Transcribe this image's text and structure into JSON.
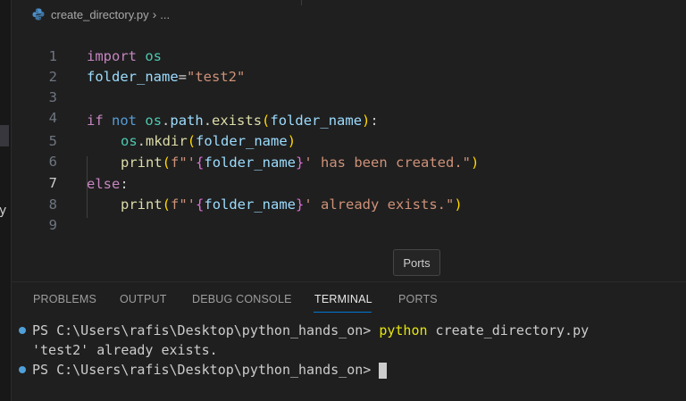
{
  "breadcrumb": {
    "file": "create_directory.py",
    "separator": "›",
    "more": "..."
  },
  "sidebar_partial_text": "y",
  "editor": {
    "active_line": 7,
    "lines": [
      {
        "n": "1"
      },
      {
        "n": "2",
        "tokens": [
          "import",
          " ",
          "os"
        ]
      },
      {
        "n": "3",
        "tokens": [
          "folder_name",
          "=",
          "\"test2\""
        ]
      },
      {
        "n": "4"
      },
      {
        "n": "5",
        "tokens": [
          "if",
          " ",
          "not",
          " ",
          "os",
          ".",
          "path",
          ".",
          "exists",
          "(",
          "folder_name",
          ")",
          ":"
        ]
      },
      {
        "n": "6",
        "tokens": [
          "os",
          ".",
          "mkdir",
          "(",
          "folder_name",
          ")"
        ]
      },
      {
        "n": "7",
        "tokens": [
          "print",
          "(",
          "f\"'",
          "{",
          "folder_name",
          "}",
          "' has been created.\"",
          ")"
        ]
      },
      {
        "n": "8",
        "tokens": [
          "else",
          ":"
        ]
      },
      {
        "n": "9",
        "tokens": [
          "print",
          "(",
          "f\"'",
          "{",
          "folder_name",
          "}",
          "' already exists.\"",
          ")"
        ]
      }
    ]
  },
  "tooltip": "Ports",
  "panel": {
    "tabs": [
      {
        "label": "PROBLEMS"
      },
      {
        "label": "OUTPUT"
      },
      {
        "label": "DEBUG CONSOLE"
      },
      {
        "label": "TERMINAL"
      },
      {
        "label": "PORTS"
      }
    ],
    "active_tab": "TERMINAL",
    "terminal": {
      "prompt": "PS C:\\Users\\rafis\\Desktop\\python_hands_on> ",
      "cmd1_exe": "python",
      "cmd1_args": " create_directory.py",
      "output1": "'test2' already exists.",
      "prompt2": "PS C:\\Users\\rafis\\Desktop\\python_hands_on> "
    }
  },
  "colors": {
    "background": "#1f1f1f",
    "keyword_purple": "#c586c0",
    "keyword_blue": "#569cd6",
    "variable": "#9cdcfe",
    "module": "#4ec9b0",
    "function": "#dcdcaa",
    "string": "#ce9178",
    "active_tab_underline": "#0078d4"
  }
}
